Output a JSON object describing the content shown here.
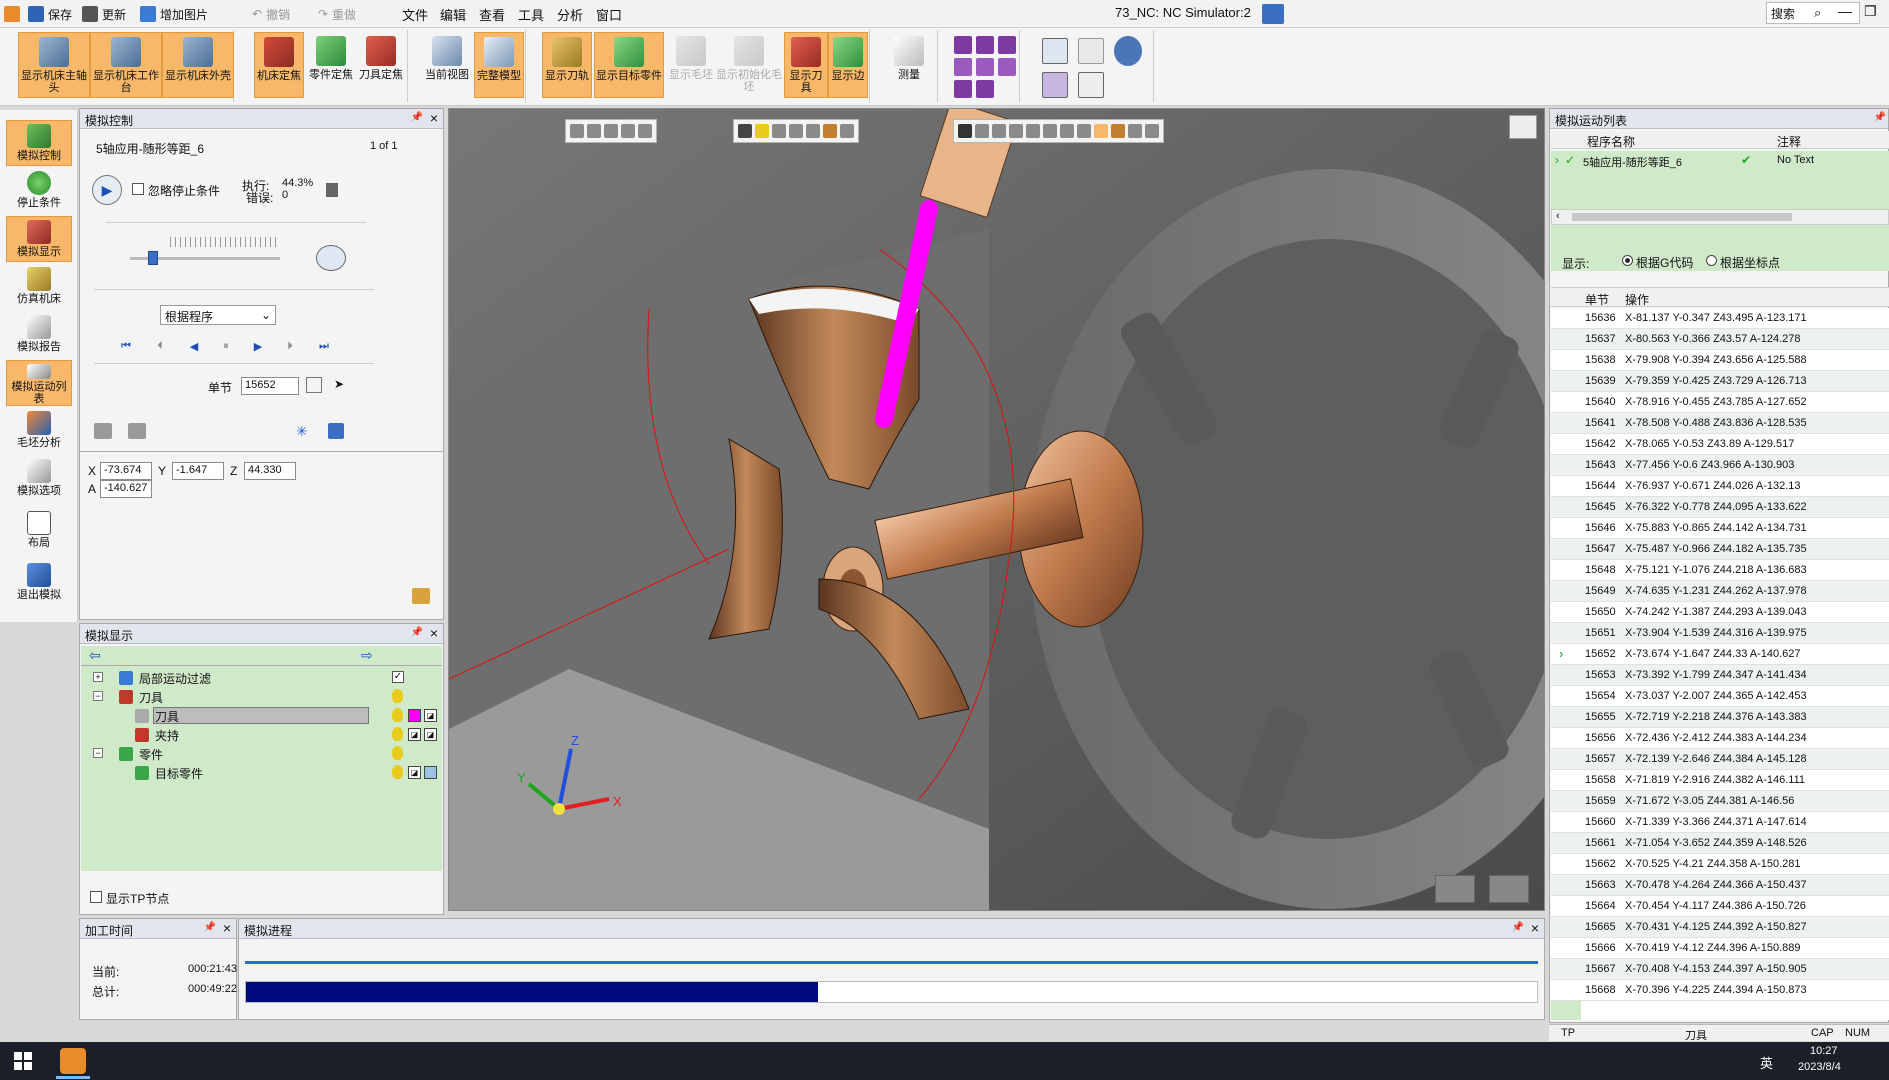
{
  "titlebar": {
    "save": "保存",
    "update": "更新",
    "add_image": "增加图片",
    "undo": "撤销",
    "redo": "重做",
    "menus": [
      "文件",
      "编辑",
      "查看",
      "工具",
      "分析",
      "窗口"
    ],
    "window_title": "73_NC: NC Simulator:2",
    "search_placeholder": "搜索"
  },
  "ribbon": {
    "group1": [
      "显示机床主轴头",
      "显示机床工作台",
      "显示机床外壳"
    ],
    "group2": [
      "机床定焦",
      "零件定焦",
      "刀具定焦"
    ],
    "group3": [
      "当前视图",
      "完整模型"
    ],
    "group4": [
      "显示刀轨",
      "显示目标零件",
      "显示毛坯",
      "显示初始化毛坯",
      "显示刀具",
      "显示边"
    ],
    "measure": "测量"
  },
  "left_toolbar": [
    "模拟控制",
    "停止条件",
    "模拟显示",
    "仿真机床",
    "模拟报告",
    "模拟运动列表",
    "毛坯分析",
    "模拟选项",
    "布局",
    "退出模拟"
  ],
  "sim_control": {
    "title": "模拟控制",
    "program": "5轴应用-随形等距_6",
    "page": "1 of 1",
    "ignore_stop": "忽略停止条件",
    "exec_label": "执行:",
    "exec_value": "44.3%",
    "error_label": "错误:",
    "error_value": "0",
    "speed_level": 0.12,
    "mode": "根据程序",
    "block_label": "单节",
    "block_value": "15652",
    "coords": {
      "x_label": "X",
      "x": "-73.674",
      "y_label": "Y",
      "y": "-1.647",
      "z_label": "Z",
      "z": "44.330",
      "a_label": "A",
      "a": "-140.627"
    }
  },
  "sim_display": {
    "title": "模拟显示",
    "tree": [
      "局部运动过滤",
      "刀具",
      "刀具",
      "夹持",
      "零件",
      "目标零件"
    ],
    "show_tp": "显示TP节点",
    "tool_color": "#ff00ff"
  },
  "motion_list": {
    "title": "模拟运动列表",
    "cols": [
      "程序名称",
      "注释"
    ],
    "program_row": {
      "name": "5轴应用-随形等距_6",
      "note": "No Text"
    },
    "display_label": "显示:",
    "radio1": "根据G代码",
    "radio2": "根据坐标点",
    "table_cols": [
      "单节",
      "操作"
    ],
    "current": "15652",
    "rows": [
      {
        "n": "15636",
        "op": "X-81.137 Y-0.347 Z43.495 A-123.171"
      },
      {
        "n": "15637",
        "op": "X-80.563 Y-0.366 Z43.57 A-124.278"
      },
      {
        "n": "15638",
        "op": "X-79.908 Y-0.394 Z43.656 A-125.588"
      },
      {
        "n": "15639",
        "op": "X-79.359 Y-0.425 Z43.729 A-126.713"
      },
      {
        "n": "15640",
        "op": "X-78.916 Y-0.455 Z43.785 A-127.652"
      },
      {
        "n": "15641",
        "op": "X-78.508 Y-0.488 Z43.836 A-128.535"
      },
      {
        "n": "15642",
        "op": "X-78.065 Y-0.53 Z43.89 A-129.517"
      },
      {
        "n": "15643",
        "op": "X-77.456 Y-0.6 Z43.966 A-130.903"
      },
      {
        "n": "15644",
        "op": "X-76.937 Y-0.671 Z44.026 A-132.13"
      },
      {
        "n": "15645",
        "op": "X-76.322 Y-0.778 Z44.095 A-133.622"
      },
      {
        "n": "15646",
        "op": "X-75.883 Y-0.865 Z44.142 A-134.731"
      },
      {
        "n": "15647",
        "op": "X-75.487 Y-0.966 Z44.182 A-135.735"
      },
      {
        "n": "15648",
        "op": "X-75.121 Y-1.076 Z44.218 A-136.683"
      },
      {
        "n": "15649",
        "op": "X-74.635 Y-1.231 Z44.262 A-137.978"
      },
      {
        "n": "15650",
        "op": "X-74.242 Y-1.387 Z44.293 A-139.043"
      },
      {
        "n": "15651",
        "op": "X-73.904 Y-1.539 Z44.316 A-139.975"
      },
      {
        "n": "15652",
        "op": "X-73.674 Y-1.647 Z44.33 A-140.627"
      },
      {
        "n": "15653",
        "op": "X-73.392 Y-1.799 Z44.347 A-141.434"
      },
      {
        "n": "15654",
        "op": "X-73.037 Y-2.007 Z44.365 A-142.453"
      },
      {
        "n": "15655",
        "op": "X-72.719 Y-2.218 Z44.376 A-143.383"
      },
      {
        "n": "15656",
        "op": "X-72.436 Y-2.412 Z44.383 A-144.234"
      },
      {
        "n": "15657",
        "op": "X-72.139 Y-2.646 Z44.384 A-145.128"
      },
      {
        "n": "15658",
        "op": "X-71.819 Y-2.916 Z44.382 A-146.111"
      },
      {
        "n": "15659",
        "op": "X-71.672 Y-3.05 Z44.381 A-146.56"
      },
      {
        "n": "15660",
        "op": "X-71.339 Y-3.366 Z44.371 A-147.614"
      },
      {
        "n": "15661",
        "op": "X-71.054 Y-3.652 Z44.359 A-148.526"
      },
      {
        "n": "15662",
        "op": "X-70.525 Y-4.21 Z44.358 A-150.281"
      },
      {
        "n": "15663",
        "op": "X-70.478 Y-4.264 Z44.366 A-150.437"
      },
      {
        "n": "15664",
        "op": "X-70.454 Y-4.117 Z44.386 A-150.726"
      },
      {
        "n": "15665",
        "op": "X-70.431 Y-4.125 Z44.392 A-150.827"
      },
      {
        "n": "15666",
        "op": "X-70.419 Y-4.12 Z44.396 A-150.889"
      },
      {
        "n": "15667",
        "op": "X-70.408 Y-4.153 Z44.397 A-150.905"
      },
      {
        "n": "15668",
        "op": "X-70.396 Y-4.225 Z44.394 A-150.873"
      }
    ]
  },
  "time_panel": {
    "title": "加工时间",
    "current_label": "当前:",
    "current": "000:21:43",
    "total_label": "总计:",
    "total": "000:49:22"
  },
  "progress_panel": {
    "title": "模拟进程",
    "progress": 0.443
  },
  "statusbar": {
    "tp": "TP",
    "tool": "刀具",
    "cap": "CAP",
    "num": "NUM"
  },
  "taskbar": {
    "lang": "英",
    "time": "10:27",
    "date": "2023/8/4"
  },
  "axes": {
    "x": "X",
    "y": "Y",
    "z": "Z"
  }
}
